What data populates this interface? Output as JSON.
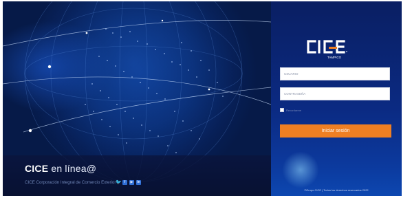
{
  "hero": {
    "brand_bold": "CICE",
    "brand_light": " en línea@",
    "subtitle": "CICE Corporación Integral de Comercio Exterior",
    "social_icons": [
      "twitter-icon",
      "facebook-icon",
      "youtube-icon",
      "linkedin-icon"
    ],
    "social_glyphs": [
      "🐦",
      "f",
      "▶",
      "in"
    ]
  },
  "login": {
    "logo_text": "CICE",
    "logo_sub": "TAMPICO",
    "username_placeholder": "USUARIO",
    "password_placeholder": "CONTRASEÑA",
    "remember_label": "Recordarme",
    "submit_label": "Iniciar sesión",
    "footer": "©Grupo CICE | Todos los derechos reservados 2022"
  },
  "colors": {
    "accent": "#ef7f23",
    "panel_dark": "#0a1f63",
    "globe_blue": "#0a2f78"
  }
}
